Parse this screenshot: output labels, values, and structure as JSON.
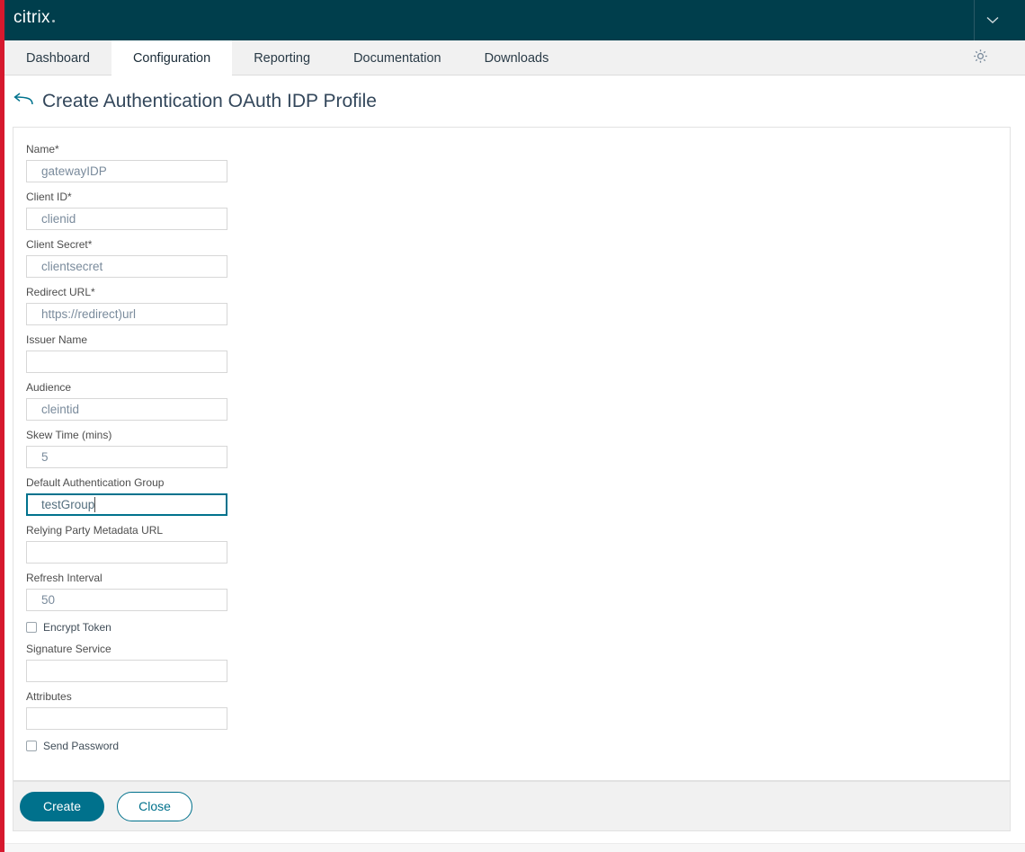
{
  "brand": {
    "name": "citrix"
  },
  "topbar": {
    "chevron_icon": "chevron-down-icon"
  },
  "nav": {
    "tabs": [
      {
        "label": "Dashboard",
        "active": false
      },
      {
        "label": "Configuration",
        "active": true
      },
      {
        "label": "Reporting",
        "active": false
      },
      {
        "label": "Documentation",
        "active": false
      },
      {
        "label": "Downloads",
        "active": false
      }
    ],
    "gear_icon": "gear-icon"
  },
  "page": {
    "back_icon": "back-arrow-icon",
    "title": "Create Authentication OAuth IDP Profile"
  },
  "form": {
    "fields": [
      {
        "label": "Name*",
        "value": "gatewayIDP",
        "focused": false,
        "type": "text"
      },
      {
        "label": "Client ID*",
        "value": "clienid",
        "focused": false,
        "type": "text"
      },
      {
        "label": "Client Secret*",
        "value": "clientsecret",
        "focused": false,
        "type": "text"
      },
      {
        "label": "Redirect URL*",
        "value": "https://redirect)url",
        "focused": false,
        "type": "text"
      },
      {
        "label": "Issuer Name",
        "value": "",
        "focused": false,
        "type": "text"
      },
      {
        "label": "Audience",
        "value": "cleintid",
        "focused": false,
        "type": "text"
      },
      {
        "label": "Skew Time (mins)",
        "value": "5",
        "focused": false,
        "type": "text"
      },
      {
        "label": "Default Authentication Group",
        "value": "testGroup",
        "focused": true,
        "type": "text"
      },
      {
        "label": "Relying Party Metadata URL",
        "value": "",
        "focused": false,
        "type": "text"
      },
      {
        "label": "Refresh Interval",
        "value": "50",
        "focused": false,
        "type": "text"
      },
      {
        "label": "Encrypt Token",
        "checked": false,
        "type": "checkbox"
      },
      {
        "label": "Signature Service",
        "value": "",
        "focused": false,
        "type": "text"
      },
      {
        "label": "Attributes",
        "value": "",
        "focused": false,
        "type": "text"
      },
      {
        "label": "Send Password",
        "checked": false,
        "type": "checkbox"
      }
    ]
  },
  "footer": {
    "create_label": "Create",
    "close_label": "Close"
  },
  "colors": {
    "header_dark_teal": "#003e4c",
    "accent_teal": "#00718c",
    "edge_red": "#d6192e",
    "tab_bar": "#f1f1f1",
    "input_text": "#7a8b9c",
    "title_text": "#33475b"
  }
}
